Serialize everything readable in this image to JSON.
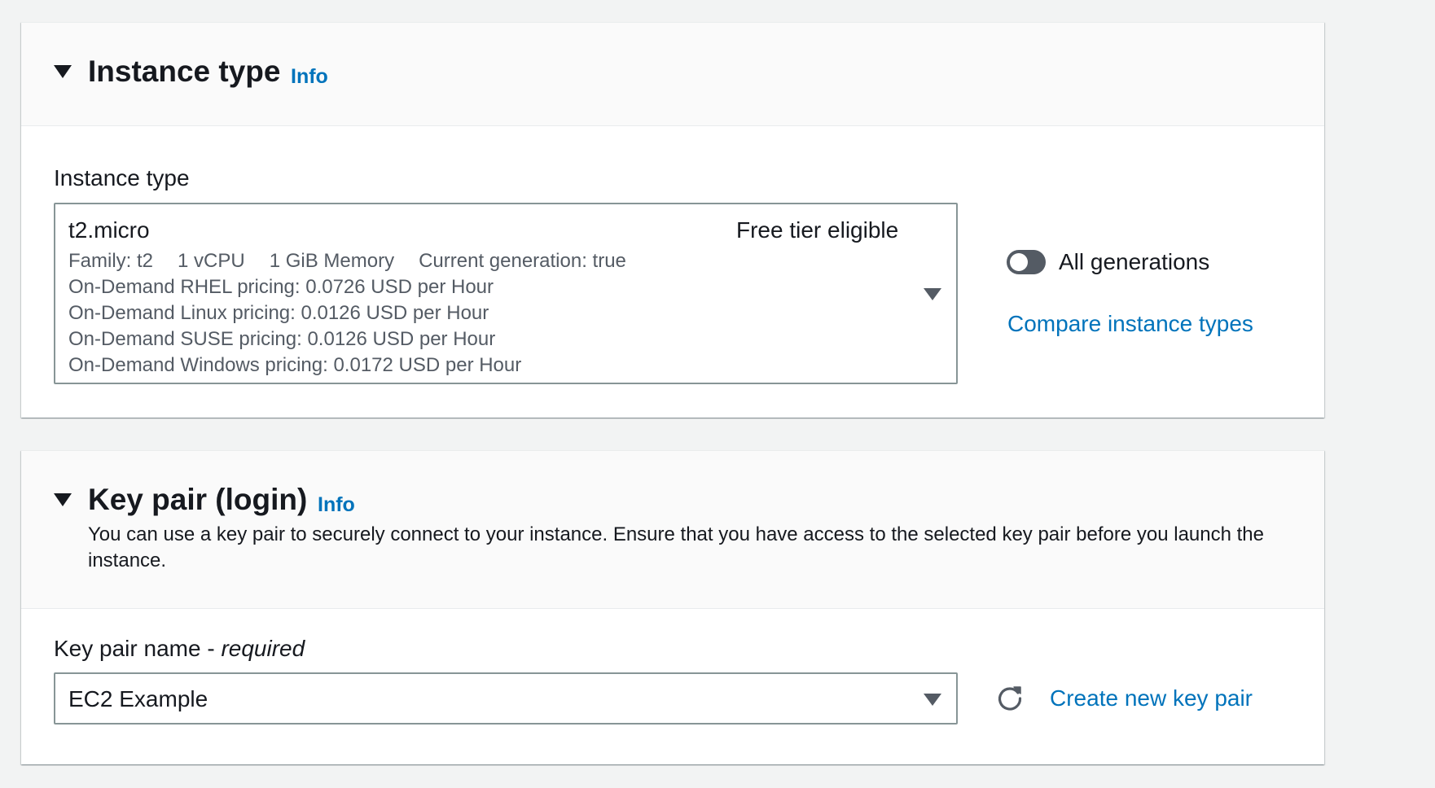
{
  "instance_type_section": {
    "title": "Instance type",
    "info_label": "Info",
    "field_label": "Instance type",
    "selected": {
      "name": "t2.micro",
      "badge": "Free tier eligible",
      "family": "Family: t2",
      "vcpu": "1 vCPU",
      "memory": "1 GiB Memory",
      "generation": "Current generation: true",
      "pricing": [
        "On-Demand RHEL pricing: 0.0726 USD per Hour",
        "On-Demand Linux pricing: 0.0126 USD per Hour",
        "On-Demand SUSE pricing: 0.0126 USD per Hour",
        "On-Demand Windows pricing: 0.0172 USD per Hour"
      ]
    },
    "toggle_label": "All generations",
    "toggle_on": false,
    "compare_link": "Compare instance types"
  },
  "key_pair_section": {
    "title": "Key pair (login)",
    "info_label": "Info",
    "description": "You can use a key pair to securely connect to your instance. Ensure that you have access to the selected key pair before you launch the instance.",
    "field_label": "Key pair name",
    "field_label_sep": " - ",
    "field_required": "required",
    "selected_value": "EC2 Example",
    "create_link": "Create new key pair"
  },
  "colors": {
    "background": "#f2f3f3",
    "link": "#0073bb",
    "text": "#16191f",
    "secondary_text": "#545b64"
  },
  "icons": [
    "expand-caret-icon",
    "dropdown-arrow-icon",
    "refresh-icon"
  ]
}
